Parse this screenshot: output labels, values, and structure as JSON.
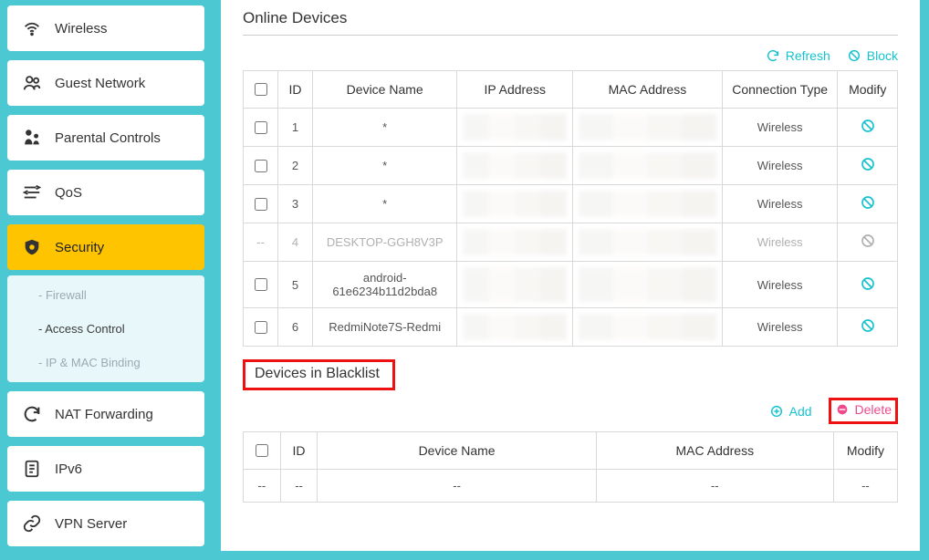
{
  "sidebar": {
    "items": [
      {
        "label": "Wireless",
        "icon": "wifi"
      },
      {
        "label": "Guest Network",
        "icon": "users"
      },
      {
        "label": "Parental Controls",
        "icon": "parental"
      },
      {
        "label": "QoS",
        "icon": "qos"
      },
      {
        "label": "Security",
        "icon": "shield",
        "active": true
      },
      {
        "label": "NAT Forwarding",
        "icon": "refresh"
      },
      {
        "label": "IPv6",
        "icon": "doc"
      },
      {
        "label": "VPN Server",
        "icon": "link"
      }
    ],
    "security_sub": [
      {
        "label": "Firewall"
      },
      {
        "label": "Access Control",
        "selected": true
      },
      {
        "label": "IP & MAC Binding"
      }
    ]
  },
  "online": {
    "title": "Online Devices",
    "refresh": "Refresh",
    "block": "Block",
    "headers": {
      "id": "ID",
      "name": "Device Name",
      "ip": "IP Address",
      "mac": "MAC Address",
      "ctype": "Connection Type",
      "modify": "Modify"
    },
    "rows": [
      {
        "id": "1",
        "name": "*",
        "ctype": "Wireless",
        "checkbox": true,
        "iconGrey": false
      },
      {
        "id": "2",
        "name": "*",
        "ctype": "Wireless",
        "checkbox": true,
        "iconGrey": false
      },
      {
        "id": "3",
        "name": "*",
        "ctype": "Wireless",
        "checkbox": true,
        "iconGrey": false
      },
      {
        "id": "4",
        "name": "DESKTOP-GGH8V3P",
        "ctype": "Wireless",
        "checkbox": false,
        "iconGrey": true
      },
      {
        "id": "5",
        "name": "android-61e6234b11d2bda8",
        "ctype": "Wireless",
        "checkbox": true,
        "iconGrey": false
      },
      {
        "id": "6",
        "name": "RedmiNote7S-Redmi",
        "ctype": "Wireless",
        "checkbox": true,
        "iconGrey": false
      }
    ]
  },
  "blacklist": {
    "title": "Devices in Blacklist",
    "add": "Add",
    "delete": "Delete",
    "headers": {
      "id": "ID",
      "name": "Device Name",
      "mac": "MAC Address",
      "modify": "Modify"
    },
    "empty": "--"
  }
}
